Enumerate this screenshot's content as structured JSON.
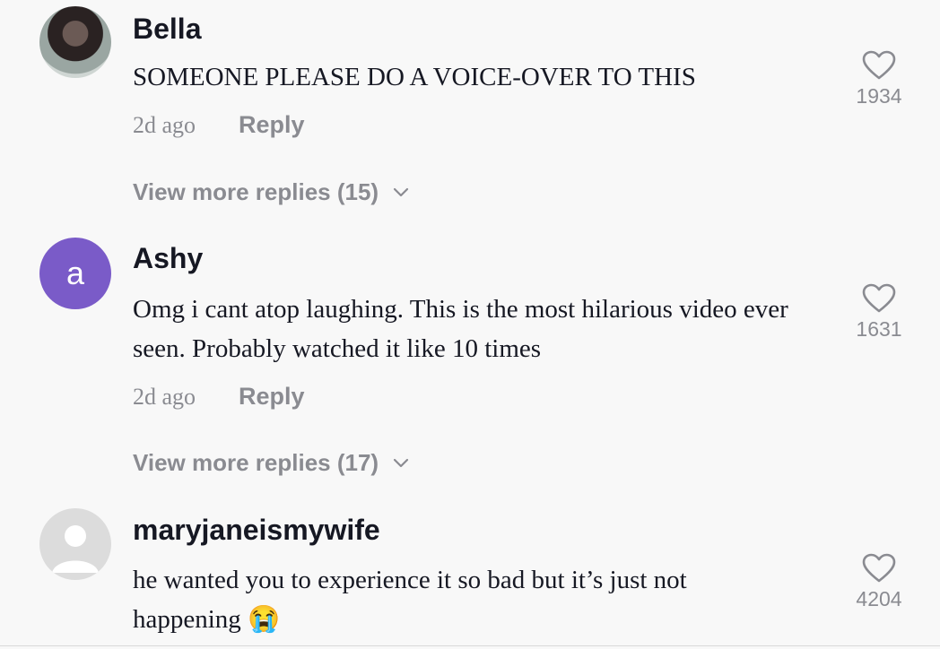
{
  "comments": [
    {
      "username": "Bella",
      "text": "SOMEONE PLEASE DO A VOICE-OVER TO THIS",
      "time": "2d ago",
      "reply_label": "Reply",
      "more_replies": "View more replies (15)",
      "likes": "1934",
      "avatar": "photo"
    },
    {
      "username": "Ashy",
      "avatar_letter": "a",
      "text": "Omg i cant atop laughing. This is the most hilarious video ever seen. Probably watched it like 10 times",
      "time": "2d ago",
      "reply_label": "Reply",
      "more_replies": "View more replies (17)",
      "likes": "1631",
      "avatar_color": "#7a5bc8"
    },
    {
      "username": "maryjaneismywife",
      "text": "he wanted you to experience it so bad but it’s just not happening 😭",
      "likes": "4204",
      "avatar": "default"
    }
  ],
  "icons": {
    "like": "heart-outline-icon",
    "expand": "chevron-down-icon",
    "default_avatar": "user-silhouette-icon"
  },
  "colors": {
    "background": "#f8f8f8",
    "text": "#161823",
    "secondary": "#8a8b91"
  }
}
